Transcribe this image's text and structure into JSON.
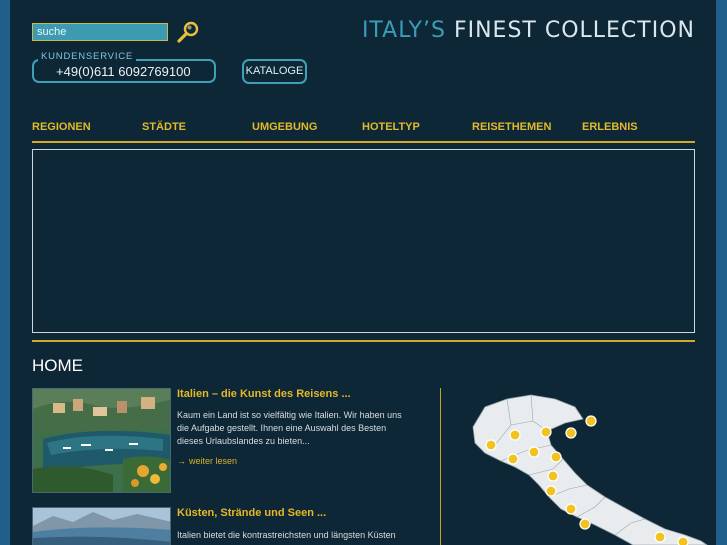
{
  "header": {
    "search_value": "suche",
    "service_label": "KUNDENSERVICE",
    "service_phone": "+49(0)611 6092769100",
    "catalog_label": "KATALOGE",
    "logo_part1": "ITALY’S",
    "logo_part2": "FINEST COLLECTION"
  },
  "nav": {
    "items": [
      {
        "label": "REGIONEN"
      },
      {
        "label": "STÄDTE"
      },
      {
        "label": "UMGEBUNG"
      },
      {
        "label": "HOTELTYP"
      },
      {
        "label": "REISETHEMEN"
      },
      {
        "label": "ERLEBNIS"
      }
    ]
  },
  "main": {
    "title": "HOME",
    "articles": [
      {
        "title": "Italien – die Kunst des Reisens ...",
        "lines": [
          "Kaum ein Land ist so vielfältig wie Italien. Wir haben uns",
          "die Aufgabe gestellt. Ihnen eine Auswahl des Besten",
          "dieses Urlaubslandes zu bieten..."
        ],
        "more": "weiter lesen"
      },
      {
        "title": "Küsten, Strände und Seen ...",
        "lines": [
          "Italien bietet die kontrastreichsten und längsten Küsten"
        ]
      }
    ]
  },
  "colors": {
    "accent": "#d4a828",
    "background": "#0e2736",
    "side": "#1f5f8a",
    "logo_blue": "#3a9db8"
  }
}
